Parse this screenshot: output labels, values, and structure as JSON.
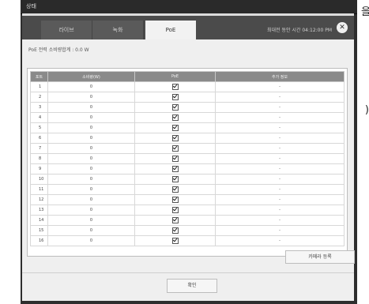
{
  "edge": {
    "top_char": "을",
    "paren": ")"
  },
  "window": {
    "title": "상태"
  },
  "tabs": [
    {
      "label": "라이브"
    },
    {
      "label": "녹화"
    },
    {
      "label": "PoE"
    }
  ],
  "uptime": "최대전 동안 시간 04:12:00 PM",
  "poe_summary": "PoE 전력 소비량합계 : 0.0 W",
  "table": {
    "headers": [
      "포트",
      "소비량(W)",
      "PoE",
      "추가 정보"
    ],
    "rows": [
      {
        "port": "1",
        "consumption": "0",
        "poe": true,
        "info": "-"
      },
      {
        "port": "2",
        "consumption": "0",
        "poe": true,
        "info": "-"
      },
      {
        "port": "3",
        "consumption": "0",
        "poe": true,
        "info": "-"
      },
      {
        "port": "4",
        "consumption": "0",
        "poe": true,
        "info": "-"
      },
      {
        "port": "5",
        "consumption": "0",
        "poe": true,
        "info": "-"
      },
      {
        "port": "6",
        "consumption": "0",
        "poe": true,
        "info": "-"
      },
      {
        "port": "7",
        "consumption": "0",
        "poe": true,
        "info": "-"
      },
      {
        "port": "8",
        "consumption": "0",
        "poe": true,
        "info": "-"
      },
      {
        "port": "9",
        "consumption": "0",
        "poe": true,
        "info": "-"
      },
      {
        "port": "10",
        "consumption": "0",
        "poe": true,
        "info": "-"
      },
      {
        "port": "11",
        "consumption": "0",
        "poe": true,
        "info": "-"
      },
      {
        "port": "12",
        "consumption": "0",
        "poe": true,
        "info": "-"
      },
      {
        "port": "13",
        "consumption": "0",
        "poe": true,
        "info": "-"
      },
      {
        "port": "14",
        "consumption": "0",
        "poe": true,
        "info": "-"
      },
      {
        "port": "15",
        "consumption": "0",
        "poe": true,
        "info": "-"
      },
      {
        "port": "16",
        "consumption": "0",
        "poe": true,
        "info": "-"
      }
    ]
  },
  "buttons": {
    "camera_register": "카메라 등록",
    "ok": "확인"
  },
  "icons": {
    "close": "close-icon",
    "checkbox": "checkbox-checked-icon"
  },
  "colors": {
    "dark": "#2e2e2e",
    "header": "#8a8a8a",
    "panel": "#efefef"
  }
}
